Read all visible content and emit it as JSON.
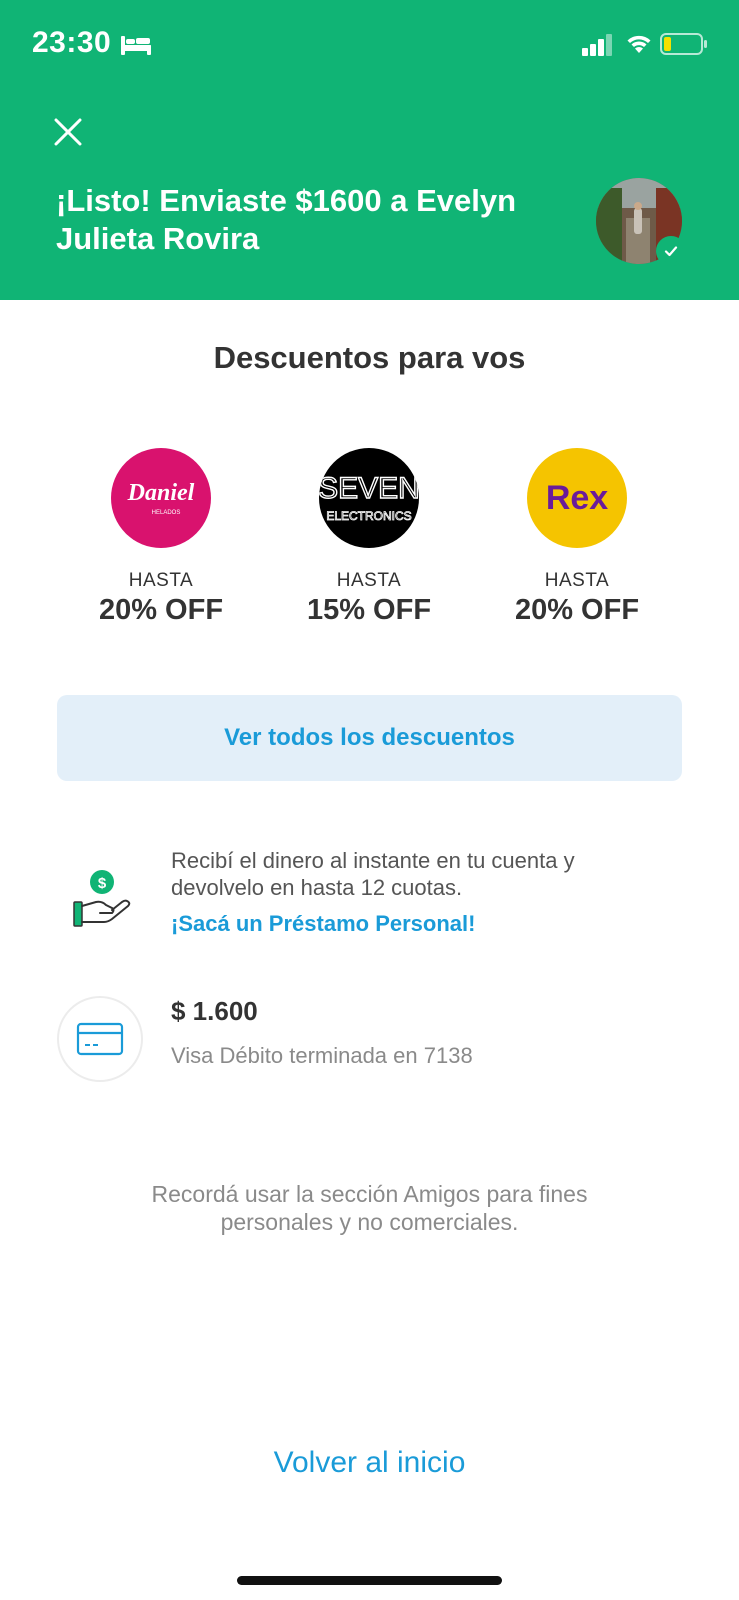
{
  "status_bar": {
    "time": "23:30"
  },
  "header": {
    "title": "¡Listo! Enviaste $1600 a Evelyn Julieta Rovira",
    "close_icon": "close-icon",
    "background_color": "#10b475"
  },
  "discounts": {
    "title": "Descuentos para vos",
    "items": [
      {
        "brand": "Daniel",
        "brand_sub": "HELADOS",
        "label": "HASTA",
        "value": "20% OFF",
        "logo_bg": "#d9126e"
      },
      {
        "brand": "SEVEN",
        "brand_sub": "ELECTRONICS",
        "label": "HASTA",
        "value": "15% OFF",
        "logo_bg": "#000000"
      },
      {
        "brand": "Rex",
        "brand_sub": "",
        "label": "HASTA",
        "value": "20% OFF",
        "logo_bg": "#f5c400"
      }
    ],
    "see_all_label": "Ver todos los descuentos"
  },
  "loan": {
    "text": "Recibí el dinero al instante en tu cuenta y devolvelo en hasta 12 cuotas.",
    "link": "¡Sacá un Préstamo Personal!"
  },
  "payment": {
    "amount": "$ 1.600",
    "method": "Visa Débito terminada en 7138"
  },
  "reminder": "Recordá usar la sección Amigos para fines personales y no comerciales.",
  "footer": {
    "back_label": "Volver al inicio"
  },
  "colors": {
    "accent": "#1a9bd8",
    "green": "#10b475"
  }
}
